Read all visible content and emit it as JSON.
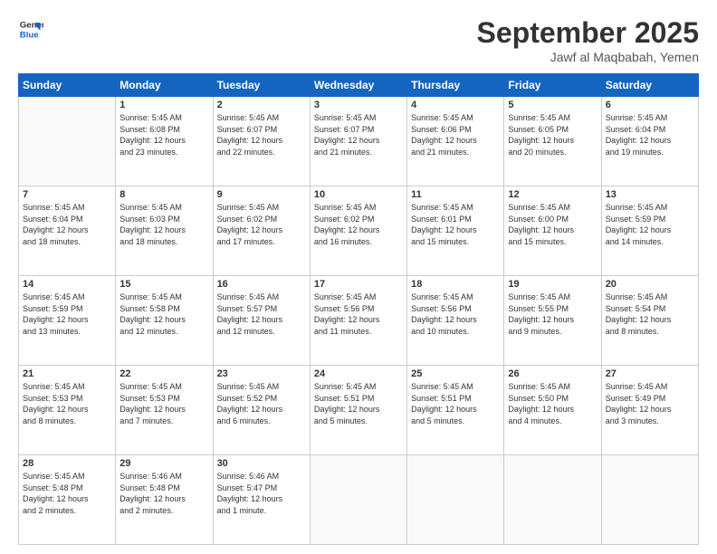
{
  "header": {
    "logo_general": "General",
    "logo_blue": "Blue",
    "month_title": "September 2025",
    "location": "Jawf al Maqbabah, Yemen"
  },
  "days": [
    "Sunday",
    "Monday",
    "Tuesday",
    "Wednesday",
    "Thursday",
    "Friday",
    "Saturday"
  ],
  "weeks": [
    [
      {
        "day": "",
        "content": ""
      },
      {
        "day": "1",
        "content": "Sunrise: 5:45 AM\nSunset: 6:08 PM\nDaylight: 12 hours\nand 23 minutes."
      },
      {
        "day": "2",
        "content": "Sunrise: 5:45 AM\nSunset: 6:07 PM\nDaylight: 12 hours\nand 22 minutes."
      },
      {
        "day": "3",
        "content": "Sunrise: 5:45 AM\nSunset: 6:07 PM\nDaylight: 12 hours\nand 21 minutes."
      },
      {
        "day": "4",
        "content": "Sunrise: 5:45 AM\nSunset: 6:06 PM\nDaylight: 12 hours\nand 21 minutes."
      },
      {
        "day": "5",
        "content": "Sunrise: 5:45 AM\nSunset: 6:05 PM\nDaylight: 12 hours\nand 20 minutes."
      },
      {
        "day": "6",
        "content": "Sunrise: 5:45 AM\nSunset: 6:04 PM\nDaylight: 12 hours\nand 19 minutes."
      }
    ],
    [
      {
        "day": "7",
        "content": "Sunrise: 5:45 AM\nSunset: 6:04 PM\nDaylight: 12 hours\nand 18 minutes."
      },
      {
        "day": "8",
        "content": "Sunrise: 5:45 AM\nSunset: 6:03 PM\nDaylight: 12 hours\nand 18 minutes."
      },
      {
        "day": "9",
        "content": "Sunrise: 5:45 AM\nSunset: 6:02 PM\nDaylight: 12 hours\nand 17 minutes."
      },
      {
        "day": "10",
        "content": "Sunrise: 5:45 AM\nSunset: 6:02 PM\nDaylight: 12 hours\nand 16 minutes."
      },
      {
        "day": "11",
        "content": "Sunrise: 5:45 AM\nSunset: 6:01 PM\nDaylight: 12 hours\nand 15 minutes."
      },
      {
        "day": "12",
        "content": "Sunrise: 5:45 AM\nSunset: 6:00 PM\nDaylight: 12 hours\nand 15 minutes."
      },
      {
        "day": "13",
        "content": "Sunrise: 5:45 AM\nSunset: 5:59 PM\nDaylight: 12 hours\nand 14 minutes."
      }
    ],
    [
      {
        "day": "14",
        "content": "Sunrise: 5:45 AM\nSunset: 5:59 PM\nDaylight: 12 hours\nand 13 minutes."
      },
      {
        "day": "15",
        "content": "Sunrise: 5:45 AM\nSunset: 5:58 PM\nDaylight: 12 hours\nand 12 minutes."
      },
      {
        "day": "16",
        "content": "Sunrise: 5:45 AM\nSunset: 5:57 PM\nDaylight: 12 hours\nand 12 minutes."
      },
      {
        "day": "17",
        "content": "Sunrise: 5:45 AM\nSunset: 5:56 PM\nDaylight: 12 hours\nand 11 minutes."
      },
      {
        "day": "18",
        "content": "Sunrise: 5:45 AM\nSunset: 5:56 PM\nDaylight: 12 hours\nand 10 minutes."
      },
      {
        "day": "19",
        "content": "Sunrise: 5:45 AM\nSunset: 5:55 PM\nDaylight: 12 hours\nand 9 minutes."
      },
      {
        "day": "20",
        "content": "Sunrise: 5:45 AM\nSunset: 5:54 PM\nDaylight: 12 hours\nand 8 minutes."
      }
    ],
    [
      {
        "day": "21",
        "content": "Sunrise: 5:45 AM\nSunset: 5:53 PM\nDaylight: 12 hours\nand 8 minutes."
      },
      {
        "day": "22",
        "content": "Sunrise: 5:45 AM\nSunset: 5:53 PM\nDaylight: 12 hours\nand 7 minutes."
      },
      {
        "day": "23",
        "content": "Sunrise: 5:45 AM\nSunset: 5:52 PM\nDaylight: 12 hours\nand 6 minutes."
      },
      {
        "day": "24",
        "content": "Sunrise: 5:45 AM\nSunset: 5:51 PM\nDaylight: 12 hours\nand 5 minutes."
      },
      {
        "day": "25",
        "content": "Sunrise: 5:45 AM\nSunset: 5:51 PM\nDaylight: 12 hours\nand 5 minutes."
      },
      {
        "day": "26",
        "content": "Sunrise: 5:45 AM\nSunset: 5:50 PM\nDaylight: 12 hours\nand 4 minutes."
      },
      {
        "day": "27",
        "content": "Sunrise: 5:45 AM\nSunset: 5:49 PM\nDaylight: 12 hours\nand 3 minutes."
      }
    ],
    [
      {
        "day": "28",
        "content": "Sunrise: 5:45 AM\nSunset: 5:48 PM\nDaylight: 12 hours\nand 2 minutes."
      },
      {
        "day": "29",
        "content": "Sunrise: 5:46 AM\nSunset: 5:48 PM\nDaylight: 12 hours\nand 2 minutes."
      },
      {
        "day": "30",
        "content": "Sunrise: 5:46 AM\nSunset: 5:47 PM\nDaylight: 12 hours\nand 1 minute."
      },
      {
        "day": "",
        "content": ""
      },
      {
        "day": "",
        "content": ""
      },
      {
        "day": "",
        "content": ""
      },
      {
        "day": "",
        "content": ""
      }
    ]
  ]
}
